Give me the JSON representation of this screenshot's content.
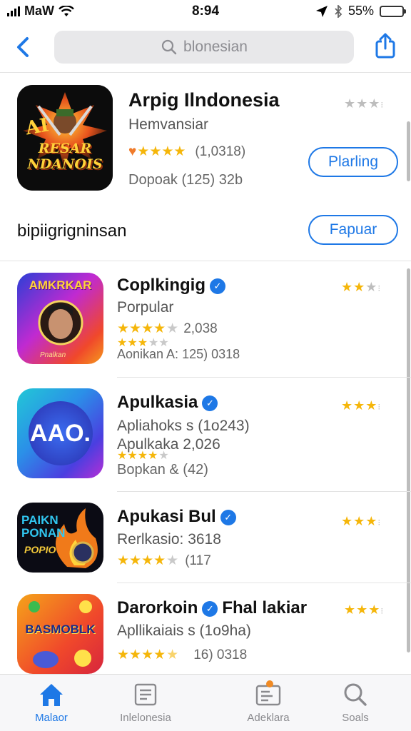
{
  "status": {
    "carrier": "MaW",
    "time": "8:94",
    "battery": "55%",
    "battery_level": 0.55,
    "battery_color": "#2ebd3b"
  },
  "nav": {
    "search_placeholder": "blonesian"
  },
  "featured": {
    "title": "Arpig Ilndonesia",
    "subtitle": "Hemvansiar",
    "rating_count": "(1,0318)",
    "stars_filled": 4,
    "meta": "Dopoak (125) 32b",
    "button": "Plarling",
    "icon_text": "RESAR NDANOIS",
    "icon_top": "AI",
    "right_stars_filled": 3
  },
  "section": {
    "title": "bipiigrigninsan",
    "button": "Fapuar"
  },
  "apps": [
    {
      "title": "Coplkingig",
      "subtitle": "Porpular",
      "stars_line": "2,038",
      "stars_filled": 4,
      "extra_stars": 3,
      "meta": "Aonikan A: 125) 0318",
      "icon_text": "AMKRKAR",
      "icon_sub": "Pnalkan",
      "verified": true,
      "right_stars_filled": 2
    },
    {
      "title": "Apulkasia",
      "subtitle": "Apliahoks s (1o243)",
      "stars_line": "Apulkaka 2,026",
      "stars_filled": 4,
      "meta": "Bopkan & (42)",
      "icon_text": "AAO.",
      "verified": true,
      "right_stars_filled": 3
    },
    {
      "title": "Apukasi Bul",
      "subtitle": "Rerlkasio: 3618",
      "stars_line": "(117",
      "stars_filled": 4,
      "meta": "",
      "icon_text": "PAIKN PONAN",
      "icon_sub": "POPIO",
      "verified": true,
      "right_stars_filled": 3
    },
    {
      "title": "Darorkoin",
      "title2": "Fhal lakiar",
      "subtitle": "Apllikaiais s (1o9ha)",
      "stars_line": "16) 0318",
      "stars_filled": 4,
      "meta": "",
      "icon_text": "BASMOBLK",
      "verified": true,
      "right_stars_filled": 3
    }
  ],
  "tabs": [
    {
      "label": "Malaor",
      "icon": "home-icon",
      "active": true
    },
    {
      "label": "Inlelonesia",
      "icon": "news-icon",
      "active": false
    },
    {
      "label": "Adeklara",
      "icon": "apps-icon",
      "active": false
    },
    {
      "label": "Soals",
      "icon": "search-icon",
      "active": false
    }
  ],
  "colors": {
    "accent": "#1e78e6",
    "star": "#f5b60a"
  }
}
